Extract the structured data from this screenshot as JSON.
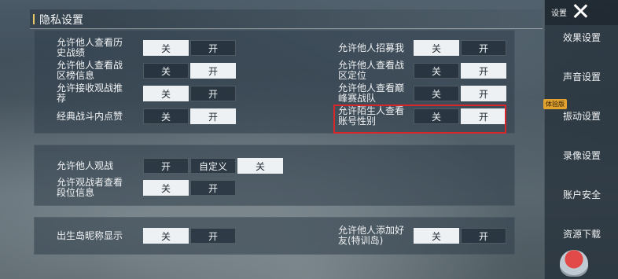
{
  "header": {
    "title": "隐私设置"
  },
  "options": {
    "off": "关",
    "on": "开",
    "custom": "自定义"
  },
  "section1": {
    "left_rows": [
      {
        "label": "允许他人查看历史战绩",
        "selected": "off"
      },
      {
        "label": "允许他人查看战区榜信息",
        "selected": "on"
      },
      {
        "label": "允许接收观战推荐",
        "selected": "off"
      },
      {
        "label": "经典战斗内点赞",
        "selected": "on"
      }
    ],
    "right_rows": [
      {
        "label": "允许他人招募我",
        "selected": "off"
      },
      {
        "label": "允许他人查看战区定位",
        "selected": "on"
      },
      {
        "label": "允许他人查看巅峰赛战队",
        "selected": "on"
      },
      {
        "label": "允许陌生人查看账号性别",
        "selected": "on",
        "highlighted": true
      }
    ]
  },
  "section2": {
    "rows": [
      {
        "label": "允许他人观战",
        "selected": "off"
      },
      {
        "label": "允许观战者查看段位信息",
        "selected": "off"
      }
    ]
  },
  "section3": {
    "left_row": {
      "label": "出生岛昵称显示",
      "selected": "off"
    },
    "right_row": {
      "label": "允许他人添加好友(特训岛)",
      "selected": "off"
    }
  },
  "sidebar": {
    "top_label": "设置",
    "badge": "体验版",
    "items": [
      {
        "label": "效果设置"
      },
      {
        "label": "声音设置"
      },
      {
        "label": "振动设置"
      },
      {
        "label": "录像设置"
      },
      {
        "label": "账户安全"
      },
      {
        "label": "资源下载"
      }
    ]
  },
  "colors": {
    "highlight_border": "#d8262a",
    "selected_bg": "#eef1f3",
    "badge_bg": "#e1a22e"
  }
}
